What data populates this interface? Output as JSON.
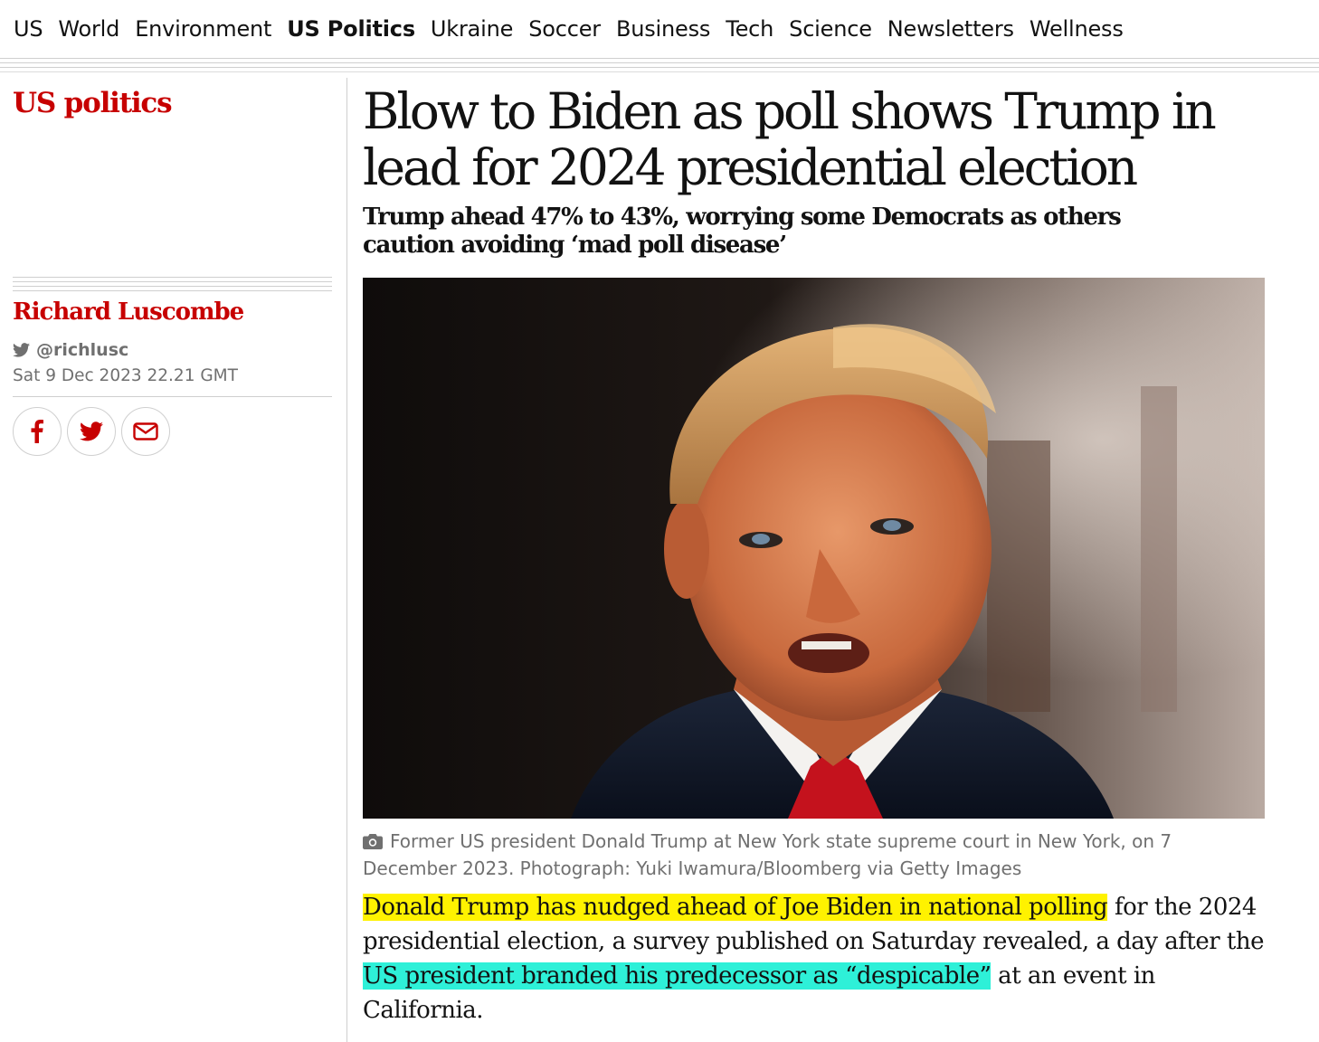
{
  "nav": {
    "items": [
      "US",
      "World",
      "Environment",
      "US Politics",
      "Ukraine",
      "Soccer",
      "Business",
      "Tech",
      "Science",
      "Newsletters",
      "Wellness"
    ],
    "active": "US Politics"
  },
  "section": {
    "title": "US politics"
  },
  "byline": {
    "author": "Richard Luscombe",
    "twitter_handle": "@richlusc",
    "date": "Sat 9 Dec 2023 22.21 GMT"
  },
  "share": {
    "icons": [
      "facebook-icon",
      "twitter-icon",
      "email-icon"
    ]
  },
  "article": {
    "headline": "Blow to Biden as poll shows Trump in lead for 2024 presidential election",
    "standfirst": "Trump ahead 47% to 43%, worrying some Democrats as others caution avoiding ‘mad poll disease’",
    "caption": "Former US president Donald Trump at New York state supreme court in New York, on 7 December 2023. Photograph: Yuki Iwamura/Bloomberg via Getty Images",
    "body": {
      "highlight_1": "Donald Trump has nudged ahead of Joe Biden in national polling",
      "text_1": " for the 2024 presidential election, a survey published on Saturday revealed, a day after the ",
      "highlight_2": "US president branded his predecessor as “despicable”",
      "text_2": " at an event in California."
    }
  },
  "colors": {
    "brand_red": "#c70000",
    "highlight_yellow": "#fff200",
    "highlight_cyan": "#2ef0d8",
    "muted_gray": "#707070"
  }
}
